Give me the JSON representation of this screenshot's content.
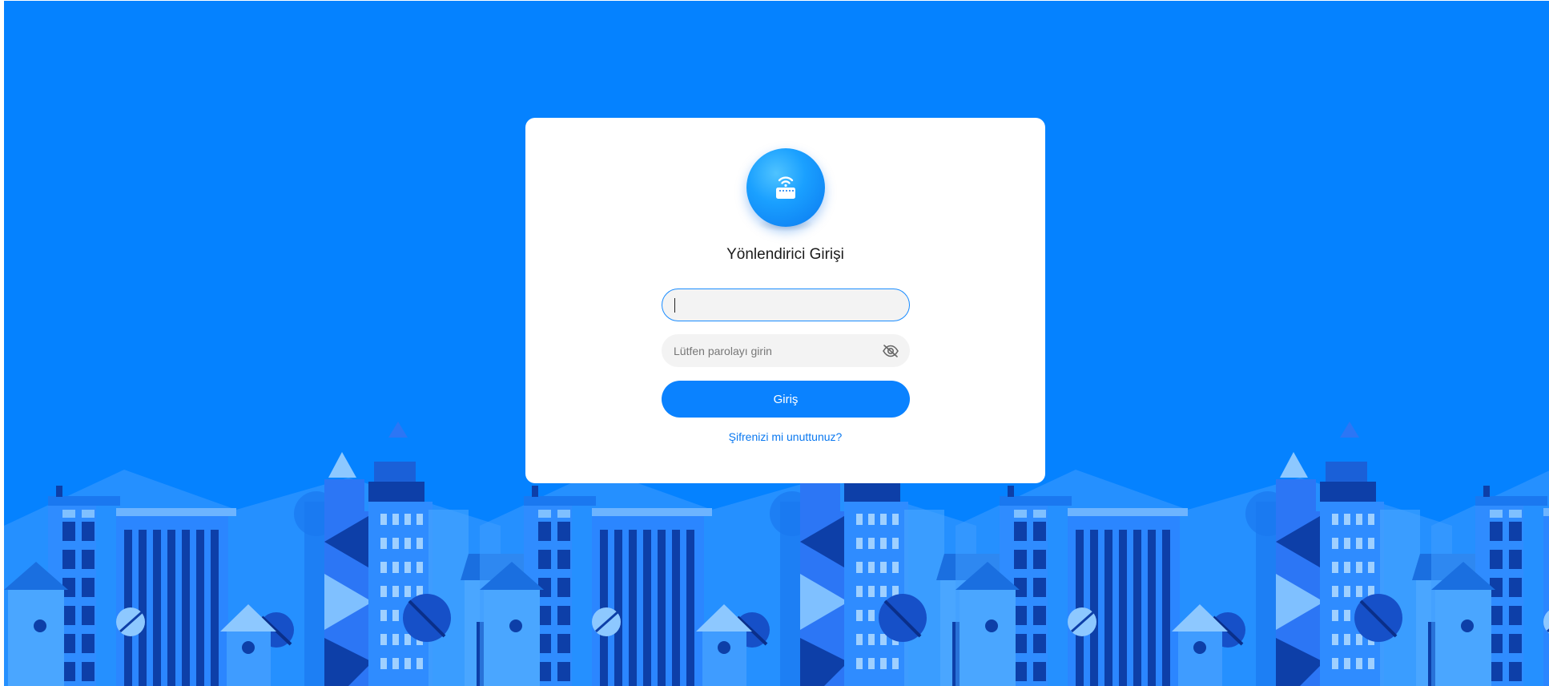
{
  "login": {
    "title": "Yönlendirici Girişi",
    "username_value": "",
    "password_placeholder": "Lütfen parolayı girin",
    "submit_label": "Giriş",
    "forgot_label": "Şifrenizi mi unuttunuz?"
  },
  "icons": {
    "logo": "router-wifi-icon",
    "password_toggle": "eye-off-icon"
  },
  "colors": {
    "background": "#0582ff",
    "accent": "#0a82ff",
    "link": "#0a78f0"
  }
}
